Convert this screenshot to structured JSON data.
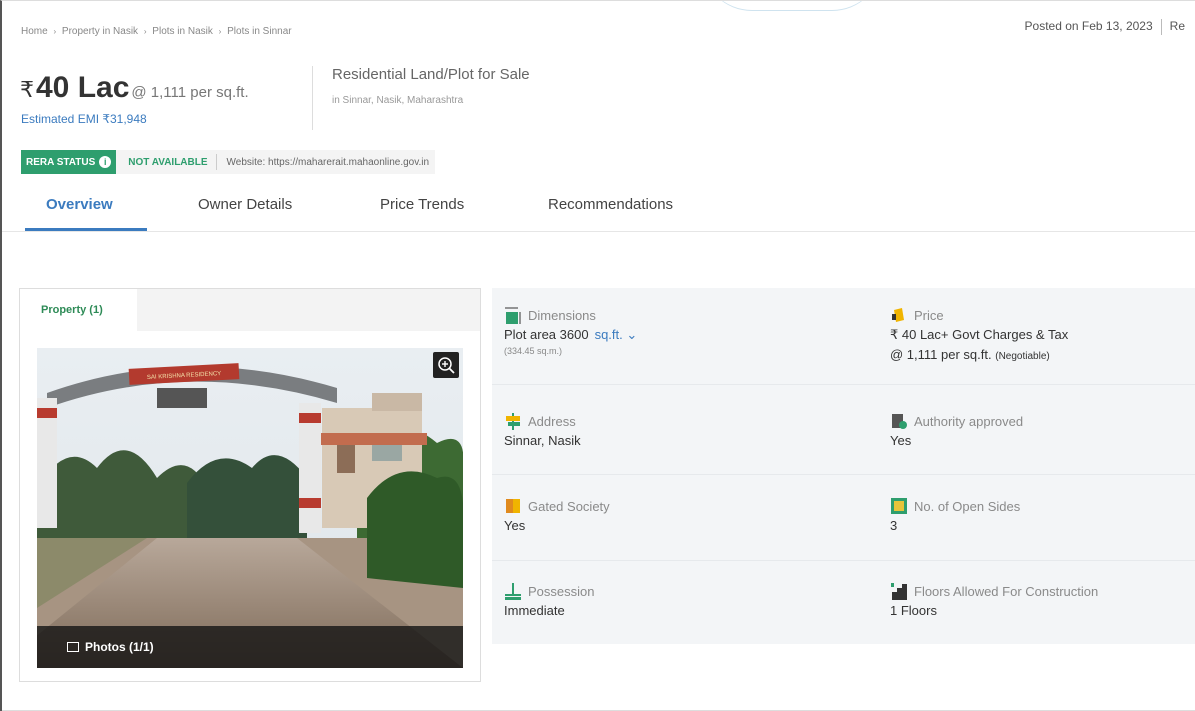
{
  "breadcrumb": [
    "Home",
    "Property in Nasik",
    "Plots in Nasik",
    "Plots in Sinnar"
  ],
  "breadcrumb_sep": "›",
  "posted": {
    "text": "Posted on Feb 13, 2023",
    "trailing": "Re"
  },
  "price": {
    "currency": "₹",
    "amount": "40 Lac",
    "rate": "@ 1,111 per sq.ft."
  },
  "emi": "Estimated EMI ₹31,948",
  "property": {
    "type": "Residential Land/Plot for Sale",
    "location": "in Sinnar, Nasik, Maharashtra"
  },
  "rera": {
    "badge": "RERA STATUS",
    "info_icon": "i",
    "status": "NOT AVAILABLE",
    "website": "Website: https://maharerait.mahaonline.gov.in"
  },
  "tabs": [
    {
      "label": "Overview",
      "active": true
    },
    {
      "label": "Owner Details",
      "active": false
    },
    {
      "label": "Price Trends",
      "active": false
    },
    {
      "label": "Recommendations",
      "active": false
    }
  ],
  "gallery": {
    "tab_label": "Property (1)",
    "photos_label": "Photos (1/1)",
    "arch_text": "SAI KRISHNA RESIDENCY"
  },
  "details": {
    "dimensions": {
      "label": "Dimensions",
      "value": "Plot area 3600",
      "unit": "sq.ft.",
      "sub": "(334.45 sq.m.)"
    },
    "price": {
      "label": "Price",
      "value": "₹ 40 Lac+ Govt Charges & Tax",
      "sub_main": "@ 1,111 per sq.ft.",
      "sub_note": "(Negotiable)"
    },
    "address": {
      "label": "Address",
      "value": "Sinnar, Nasik"
    },
    "authority": {
      "label": "Authority approved",
      "value": "Yes"
    },
    "gated": {
      "label": "Gated Society",
      "value": "Yes"
    },
    "open_sides": {
      "label": "No. of Open Sides",
      "value": "3"
    },
    "possession": {
      "label": "Possession",
      "value": "Immediate"
    },
    "floors": {
      "label": "Floors Allowed For Construction",
      "value": "1 Floors"
    }
  },
  "colors": {
    "accent": "#3b7bbf",
    "rera_green": "#2e9e6e"
  }
}
